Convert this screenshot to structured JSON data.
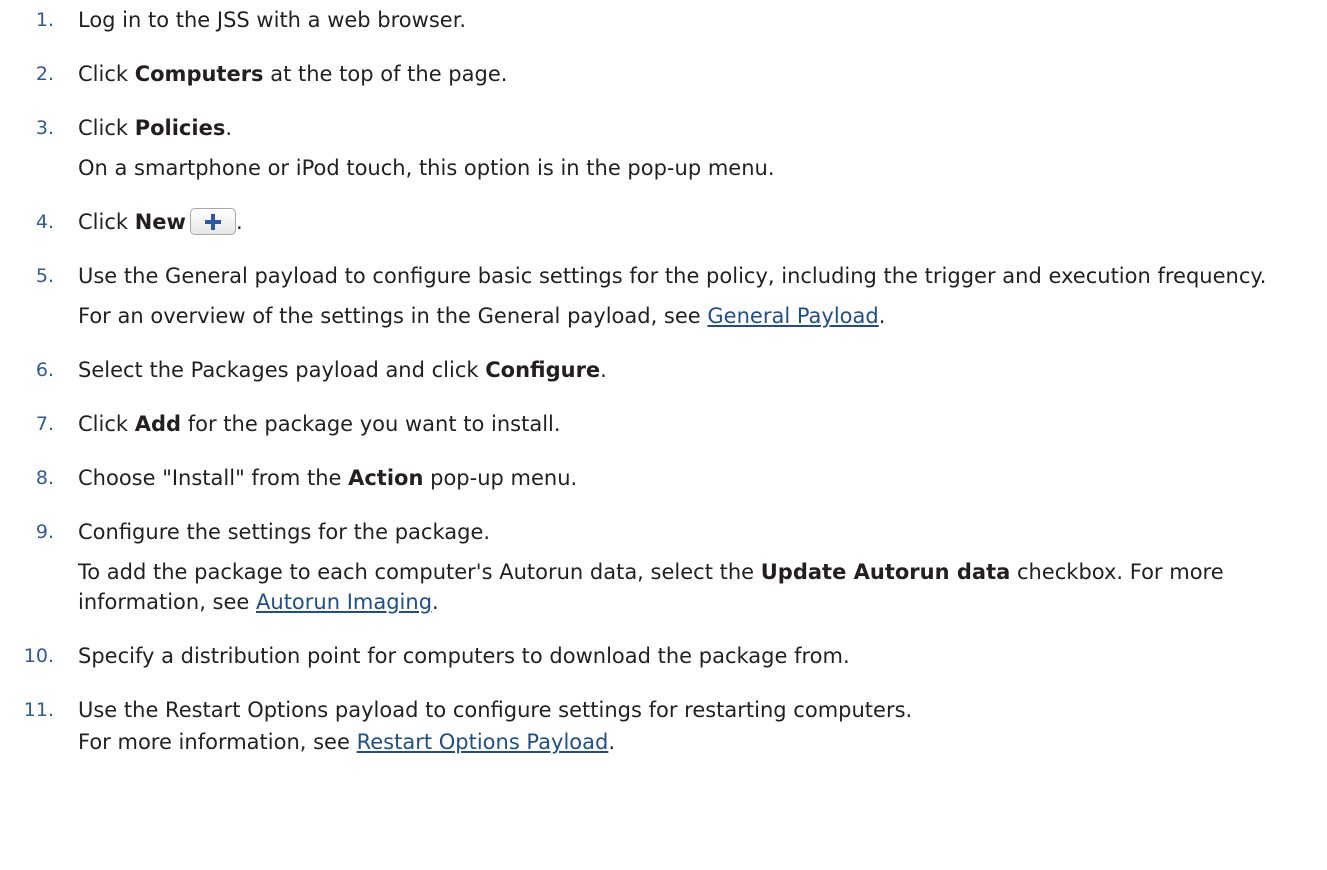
{
  "steps": [
    {
      "num": "1.",
      "text": "Log in to the JSS with a web browser."
    },
    {
      "num": "2.",
      "pre": "Click ",
      "bold": "Computers",
      "post": " at the top of the page."
    },
    {
      "num": "3.",
      "pre": "Click ",
      "bold": "Policies",
      "post": ".",
      "note": "On a smartphone or iPod touch, this option is in the pop-up menu."
    },
    {
      "num": "4.",
      "pre": "Click ",
      "bold": "New",
      "post": ".",
      "icon": "plus-icon"
    },
    {
      "num": "5.",
      "text": "Use the General payload to configure basic settings for the policy, including the trigger and execution frequency.",
      "note_pre": "For an overview of the settings in the General payload, see ",
      "note_link": "General Payload",
      "note_post": "."
    },
    {
      "num": "6.",
      "pre": "Select the Packages payload and click ",
      "bold": "Configure",
      "post": "."
    },
    {
      "num": "7.",
      "pre": "Click ",
      "bold": "Add",
      "post": " for the package you want to install."
    },
    {
      "num": "8.",
      "pre": "Choose \"Install\" from the ",
      "bold": "Action",
      "post": " pop-up menu."
    },
    {
      "num": "9.",
      "text": "Configure the settings for the package.",
      "note_pre": "To add the package to each computer's Autorun data, select the ",
      "note_bold": "Update Autorun data",
      "note_mid": " checkbox. For more information, see ",
      "note_link": "Autorun Imaging",
      "note_post": "."
    },
    {
      "num": "10.",
      "text": "Specify a distribution point for computers to download the package from."
    },
    {
      "num": "11.",
      "text": "Use the Restart Options payload to configure settings for restarting computers.",
      "note_pre": "For more information, see ",
      "note_link": "Restart Options Payload",
      "note_post": "."
    }
  ],
  "colors": {
    "number": "#2f5b8f",
    "link": "#1f4e89",
    "text": "#231f20"
  }
}
